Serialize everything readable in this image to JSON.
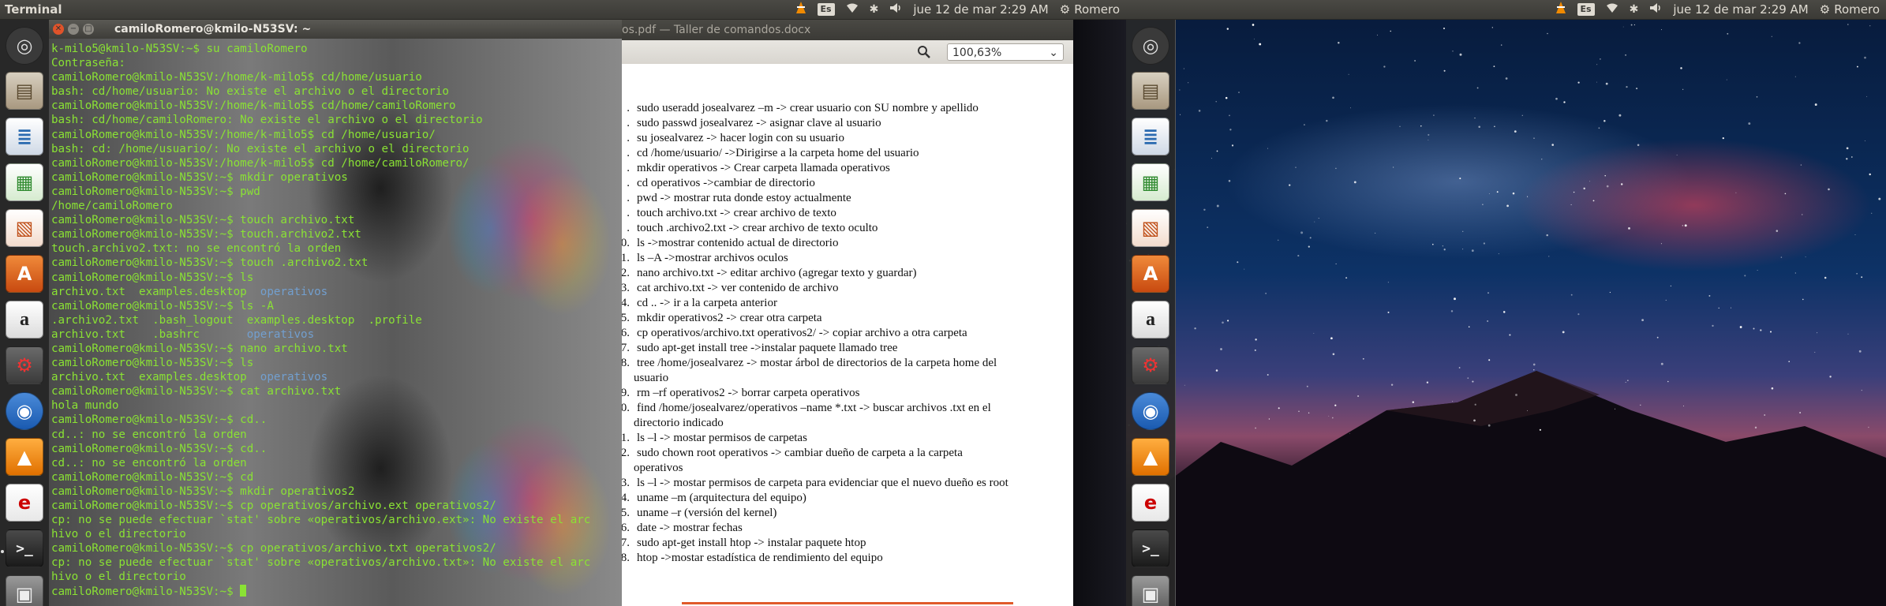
{
  "screen1": {
    "topbar": {
      "app_title": "Terminal",
      "keyboard": "Es",
      "datetime": "jue 12 de mar  2:29 AM",
      "user": "Romero"
    },
    "terminal": {
      "title": "camiloRomero@kmilo-N53SV: ~",
      "lines": [
        {
          "text": "k-milo5@kmilo-N53SV:~$ su camiloRomero",
          "color": "green"
        },
        {
          "text": "Contraseña:",
          "color": "green"
        },
        {
          "text": "camiloRomero@kmilo-N53SV:/home/k-milo5$ cd/home/usuario",
          "color": "green"
        },
        {
          "text": "bash: cd/home/usuario: No existe el archivo o el directorio",
          "color": "green"
        },
        {
          "text": "camiloRomero@kmilo-N53SV:/home/k-milo5$ cd/home/camiloRomero",
          "color": "green"
        },
        {
          "text": "bash: cd/home/camiloRomero: No existe el archivo o el directorio",
          "color": "green"
        },
        {
          "text": "camiloRomero@kmilo-N53SV:/home/k-milo5$ cd /home/usuario/",
          "color": "green"
        },
        {
          "text": "bash: cd: /home/usuario/: No existe el archivo o el directorio",
          "color": "green"
        },
        {
          "text": "camiloRomero@kmilo-N53SV:/home/k-milo5$ cd /home/camiloRomero/",
          "color": "green"
        },
        {
          "text": "camiloRomero@kmilo-N53SV:~$ mkdir operativos",
          "color": "green"
        },
        {
          "text": "camiloRomero@kmilo-N53SV:~$ pwd",
          "color": "green"
        },
        {
          "text": "/home/camiloRomero",
          "color": "green"
        },
        {
          "text": "camiloRomero@kmilo-N53SV:~$ touch archivo.txt",
          "color": "green"
        },
        {
          "text": "camiloRomero@kmilo-N53SV:~$ touch.archivo2.txt",
          "color": "green"
        },
        {
          "text": "touch.archivo2.txt: no se encontró la orden",
          "color": "green"
        },
        {
          "text": "camiloRomero@kmilo-N53SV:~$ touch .archivo2.txt",
          "color": "green"
        },
        {
          "text": "camiloRomero@kmilo-N53SV:~$ ls",
          "color": "green"
        },
        {
          "text": "archivo.txt  examples.desktop  operativos",
          "color": "green"
        },
        {
          "text": "camiloRomero@kmilo-N53SV:~$ ls -A",
          "color": "green"
        },
        {
          "text": ".archivo2.txt  .bash_logout  examples.desktop  .profile",
          "color": "green"
        },
        {
          "text": "archivo.txt    .bashrc       operativos",
          "color": "green"
        },
        {
          "text": "camiloRomero@kmilo-N53SV:~$ nano archivo.txt",
          "color": "green"
        },
        {
          "text": "camiloRomero@kmilo-N53SV:~$ ls",
          "color": "green"
        },
        {
          "text": "archivo.txt  examples.desktop  operativos",
          "color": "green"
        },
        {
          "text": "camiloRomero@kmilo-N53SV:~$ cat archivo.txt",
          "color": "green"
        },
        {
          "text": "hola mundo",
          "color": "green"
        },
        {
          "text": "camiloRomero@kmilo-N53SV:~$ cd..",
          "color": "green"
        },
        {
          "text": "cd..: no se encontró la orden",
          "color": "green"
        },
        {
          "text": "camiloRomero@kmilo-N53SV:~$ cd..",
          "color": "green"
        },
        {
          "text": "cd..: no se encontró la orden",
          "color": "green"
        },
        {
          "text": "camiloRomero@kmilo-N53SV:~$ cd",
          "color": "green"
        },
        {
          "text": "camiloRomero@kmilo-N53SV:~$ mkdir operativos2",
          "color": "green"
        },
        {
          "text": "camiloRomero@kmilo-N53SV:~$ cp operativos/archivo.ext operativos2/",
          "color": "green"
        },
        {
          "text": "cp: no se puede efectuar `stat' sobre «operativos/archivo.ext»: No existe el arc",
          "color": "green"
        },
        {
          "text": "hivo o el directorio",
          "color": "green"
        },
        {
          "text": "camiloRomero@kmilo-N53SV:~$ cp operativos/archivo.txt operativos2/",
          "color": "green"
        },
        {
          "text": "cp: no se puede efectuar `stat' sobre «operativos/archivo.txt»: No existe el arc",
          "color": "green"
        },
        {
          "text": "hivo o el directorio",
          "color": "green"
        },
        {
          "text": "camiloRomero@kmilo-N53SV:~$ ",
          "color": "green"
        }
      ]
    },
    "document": {
      "title": "os.pdf — Taller de comandos.docx",
      "zoom": "100,63%",
      "lines": [
        {
          "num": ".",
          "text": "sudo  useradd josealvarez –m -> crear usuario con SU nombre y apellido"
        },
        {
          "num": ".",
          "text": "sudo passwd josealvarez -> asignar clave al usuario"
        },
        {
          "num": ".",
          "text": "su josealvarez -> hacer login con su usuario"
        },
        {
          "num": ".",
          "text": "cd /home/usuario/ ->Dirigirse a la carpeta home del usuario"
        },
        {
          "num": ".",
          "text": "mkdir operativos -> Crear carpeta llamada operativos"
        },
        {
          "num": ".",
          "text": "cd operativos ->cambiar de directorio"
        },
        {
          "num": ".",
          "text": "pwd -> mostrar ruta donde estoy actualmente"
        },
        {
          "num": ".",
          "text": "touch archivo.txt -> crear archivo de texto"
        },
        {
          "num": ".",
          "text": "touch .archivo2.txt -> crear archivo de texto oculto"
        },
        {
          "num": "0.",
          "text": "ls ->mostrar contenido actual de directorio"
        },
        {
          "num": "1.",
          "text": "ls –A ->mostrar archivos oculos"
        },
        {
          "num": "2.",
          "text": "nano archivo.txt -> editar archivo (agregar texto y guardar)"
        },
        {
          "num": "3.",
          "text": "cat archivo.txt -> ver contenido de archivo"
        },
        {
          "num": "4.",
          "text": "cd .. -> ir a la carpeta anterior"
        },
        {
          "num": "5.",
          "text": "mkdir operativos2 -> crear otra carpeta"
        },
        {
          "num": "6.",
          "text": "cp operativos/archivo.txt operativos2/ -> copiar archivo a otra carpeta"
        },
        {
          "num": "7.",
          "text": "sudo apt-get install tree ->instalar paquete llamado tree"
        },
        {
          "num": "8.",
          "text": "tree /home/josealvarez -> mostar árbol de directorios de la carpeta home del",
          "cont": "usuario"
        },
        {
          "num": "9.",
          "text": "rm –rf operativos2 -> borrar carpeta operativos"
        },
        {
          "num": "0.",
          "text": "find /home/josealvarez/operativos –name *.txt -> buscar archivos .txt en el",
          "cont": "directorio indicado"
        },
        {
          "num": "1.",
          "text": "ls –l -> mostar permisos de carpetas"
        },
        {
          "num": "2.",
          "text": "sudo chown root operativos -> cambiar dueño de carpeta a la carpeta",
          "cont": "operativos"
        },
        {
          "num": "3.",
          "text": "ls –l -> mostar permisos de carpeta para evidenciar que el nuevo dueño es root"
        },
        {
          "num": "4.",
          "text": "uname –m (arquitectura del equipo)"
        },
        {
          "num": "5.",
          "text": "uname –r (versión del kernel)"
        },
        {
          "num": "6.",
          "text": "date -> mostrar fechas"
        },
        {
          "num": "7.",
          "text": "sudo apt-get install htop -> instalar paquete htop"
        },
        {
          "num": "8.",
          "text": "htop ->mostar estadística de rendimiento del equipo"
        }
      ]
    }
  },
  "screen2": {
    "topbar": {
      "keyboard": "Es",
      "datetime": "jue 12 de mar  2:29 AM",
      "user": "Romero"
    }
  },
  "launcher_icons": [
    "dash-home-icon",
    "files-icon",
    "writer-icon",
    "calc-icon",
    "impress-icon",
    "software-center-icon",
    "amazon-icon",
    "system-settings-icon",
    "chromium-icon",
    "vlc-icon",
    "ebook-reader-icon",
    "terminal-icon",
    "workspace-switcher-icon"
  ],
  "colors": {
    "terminal_text": "#8ae234",
    "terminal_dir": "#729fcf",
    "launcher_bg": "#282828"
  }
}
